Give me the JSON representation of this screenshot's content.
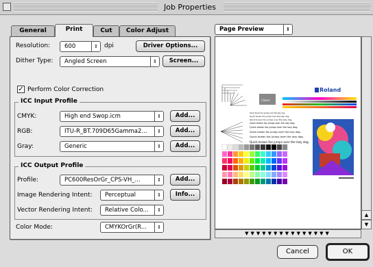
{
  "window": {
    "title": "Job Properties"
  },
  "tabs": [
    "General",
    "Print",
    "Cut",
    "Color Adjust"
  ],
  "print_tab": {
    "resolution": {
      "label": "Resolution:",
      "value": "600",
      "unit": "dpi",
      "button": "Driver Options..."
    },
    "dither": {
      "label": "Dither Type:",
      "value": "Angled Screen",
      "button": "Screen..."
    },
    "color_correction": {
      "label": "Perform Color Correction",
      "checked": true
    },
    "icc_input": {
      "title": "ICC Input Profile",
      "cmyk": {
        "label": "CMYK:",
        "value": "High end Swop.icm",
        "button": "Add..."
      },
      "rgb": {
        "label": "RGB:",
        "value": "ITU-R_BT.709D65Gamma2...",
        "button": "Add..."
      },
      "gray": {
        "label": "Gray:",
        "value": "Generic",
        "button": "Add..."
      }
    },
    "icc_output": {
      "title": "ICC Output Profile",
      "profile": {
        "label": "Profile:",
        "value": "PC600ResOrGr_CPS-VH_...",
        "button": "Add..."
      },
      "image_intent": {
        "label": "Image Rendering Intent:",
        "value": "Perceptual",
        "button": "Info..."
      },
      "vector_intent": {
        "label": "Vector Rendering Intent:",
        "value": "Relative Colo..."
      }
    },
    "color_mode": {
      "label": "Color Mode:",
      "value": "CMYKOrGr(R..."
    }
  },
  "preview": {
    "dropdown": "Page Preview",
    "logo": "Roland",
    "colors_label": "Colors",
    "sample_lines": [
      "Quick brown fox jumps over the lazy dog.",
      "Quick brown fox jumps over the lazy dog.",
      "Quick brown fox jumps over the lazy dog.",
      "Quick brown fox jumps over the lazy dog.",
      "Quick brown fox jumps over the lazy dog.",
      "Quick brown fox jumps over the lazy dog.",
      "Quick brown fox jumps over the lazy dog.",
      "Quick brown fox jumps over the lazy dog."
    ],
    "nav_arrows": "▼▼▼▼▼▼▼▼▼▼▼▼▼▼▼"
  },
  "buttons": {
    "cancel": "Cancel",
    "ok": "OK"
  },
  "icons": {
    "popup_arrow": "⇕",
    "checkmark": "✓",
    "scroll_up": "▲",
    "scroll_down": "▼"
  }
}
